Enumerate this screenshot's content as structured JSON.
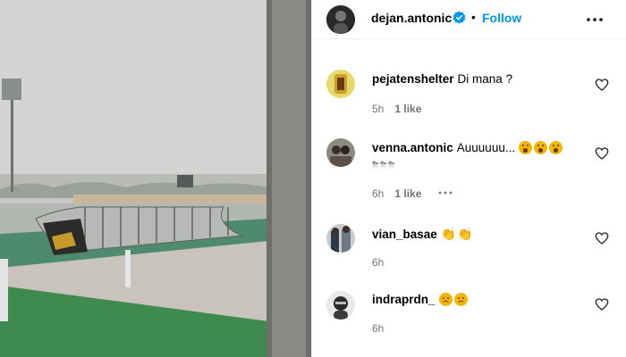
{
  "post": {
    "username": "dejan.antonic",
    "follow_label": "Follow",
    "separator": "•"
  },
  "comments": [
    {
      "username": "pejatenshelter",
      "text": "Di mana ?",
      "time": "5h",
      "likes": "1 like"
    },
    {
      "username": "venna.antonic",
      "text": "Auuuuuu...",
      "time": "6h",
      "likes": "1 like",
      "extra_line": "⛈⛈⛈"
    },
    {
      "username": "vian_basae",
      "text": "",
      "time": "6h"
    },
    {
      "username": "indraprdn_",
      "text": "",
      "time": "6h"
    }
  ],
  "icons": {
    "verified": "verified-badge-icon",
    "more": "more-options-icon",
    "heart": "heart-icon",
    "comment_options": "more-horizontal-icon"
  },
  "colors": {
    "link": "#0095f6",
    "meta": "#737373",
    "verified": "#0095f6"
  }
}
